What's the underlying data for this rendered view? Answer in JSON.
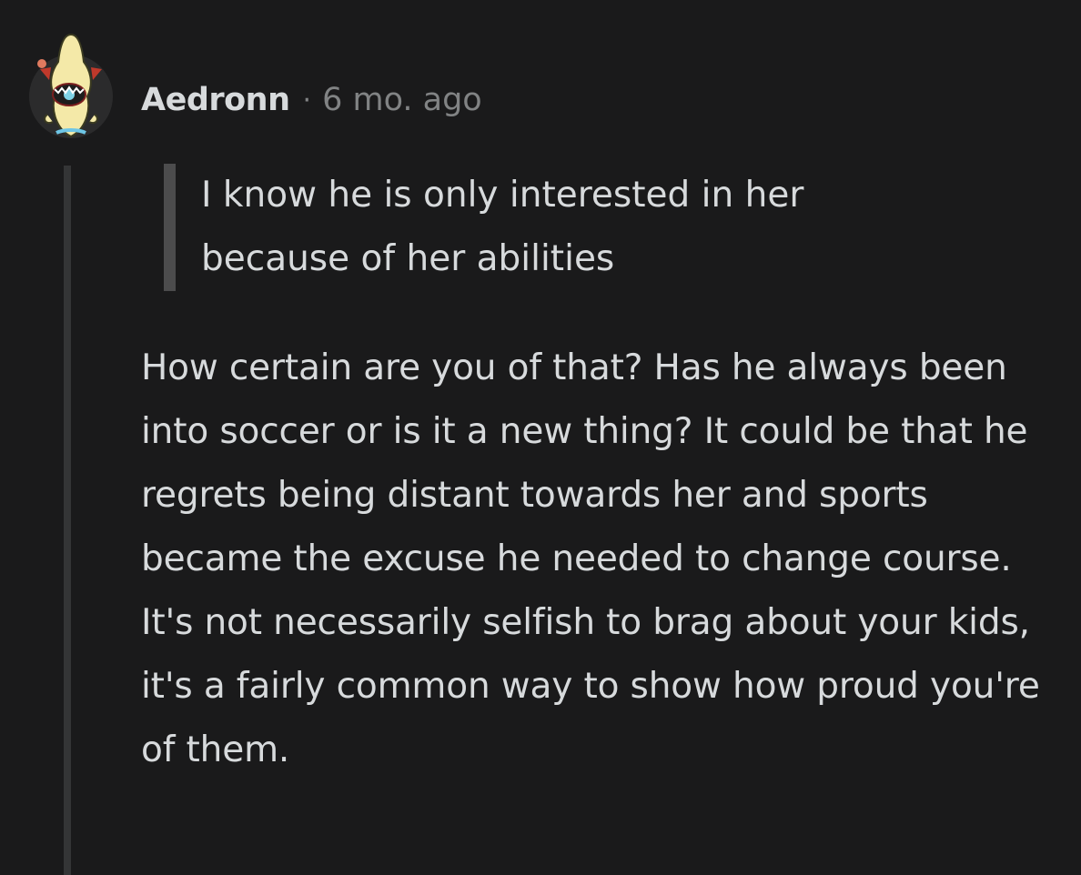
{
  "comment": {
    "author": "Aedronn",
    "separator": "·",
    "timestamp": "6 mo. ago",
    "avatar_icon": "demogorgon-cartoon-avatar-icon",
    "quote": "I know he is only interested in her because of her abilities",
    "body": "How certain are you of that? Has he always been into soccer or is it a new thing? It could be that he regrets being distant towards her and sports became the excuse he needed to change course. It's not necessarily selfish to brag about your kids, it's a fairly common way to show how proud you're of them."
  },
  "colors": {
    "background": "#1a1a1b",
    "text": "#d7dadc",
    "muted": "#818384",
    "quote_bar": "#4c4c4d",
    "thread_line": "#343536"
  }
}
